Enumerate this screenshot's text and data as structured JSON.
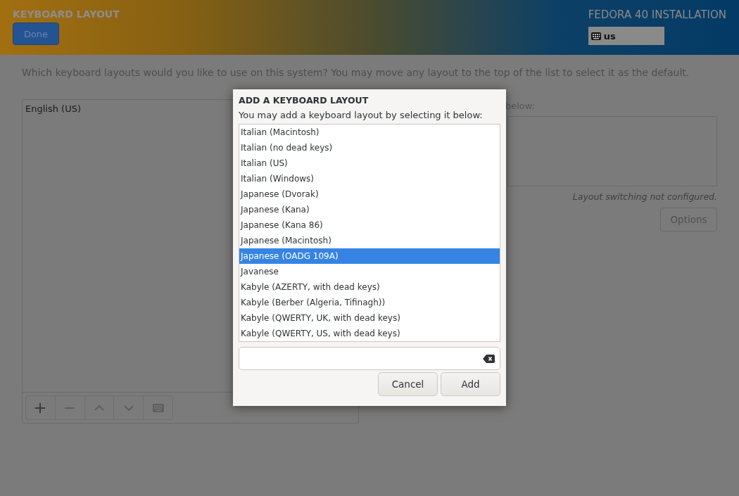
{
  "header": {
    "title": "KEYBOARD LAYOUT",
    "done_button": "Done",
    "product": "FEDORA 40 INSTALLATION",
    "layout_indicator": "us"
  },
  "instructions": "Which keyboard layouts would you like to use on this system?  You may move any layout to the top of the list to select it as the default.",
  "layouts": [
    {
      "label": "English (US)",
      "selected": false
    }
  ],
  "switching": {
    "label": "below:",
    "status": "Layout switching not configured.",
    "options_button": "Options"
  },
  "dialog": {
    "title": "ADD A KEYBOARD LAYOUT",
    "prompt": "You may add a keyboard layout by selecting it below:",
    "items": [
      {
        "label": "Italian (Macintosh)",
        "selected": false
      },
      {
        "label": "Italian (no dead keys)",
        "selected": false
      },
      {
        "label": "Italian (US)",
        "selected": false
      },
      {
        "label": "Italian (Windows)",
        "selected": false
      },
      {
        "label": "Japanese (Dvorak)",
        "selected": false
      },
      {
        "label": "Japanese (Kana)",
        "selected": false
      },
      {
        "label": "Japanese (Kana 86)",
        "selected": false
      },
      {
        "label": "Japanese (Macintosh)",
        "selected": false
      },
      {
        "label": "Japanese (OADG 109A)",
        "selected": true
      },
      {
        "label": "Javanese",
        "selected": false
      },
      {
        "label": "Kabyle (AZERTY, with dead keys)",
        "selected": false
      },
      {
        "label": "Kabyle (Berber (Algeria, Tifinagh))",
        "selected": false
      },
      {
        "label": "Kabyle (QWERTY, UK, with dead keys)",
        "selected": false
      },
      {
        "label": "Kabyle (QWERTY, US, with dead keys)",
        "selected": false
      }
    ],
    "buttons": [
      {
        "label": "Cancel"
      },
      {
        "label": "Add"
      }
    ]
  }
}
